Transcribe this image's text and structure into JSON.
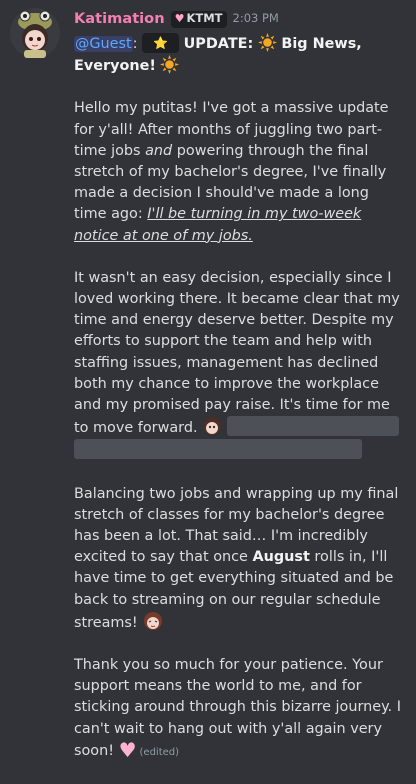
{
  "message": {
    "author": "Katimation",
    "author_color": "#f47fb0",
    "role_tag": {
      "icon": "pink-heart-icon",
      "label": "KTMT"
    },
    "timestamp": "2:03 PM",
    "mention": "@Guest",
    "mention_suffix": ":",
    "inline_badge_icon": "star-icon",
    "headline_prefix": "UPDATE:",
    "headline_suffix": "Big News, Everyone!",
    "p1": {
      "a": "Hello my putitas! I've got a massive update for y'all! After months of juggling two part-time jobs ",
      "b": "and",
      "c": " powering through the final stretch of my bachelor's degree, I've finally made a decision I should've made a long time ago: ",
      "d": "I'll be turning in my two-week notice at one of my jobs."
    },
    "p2": {
      "text": "It wasn't an easy decision, especially since I loved working there. It became clear that my time and energy deserve better. Despite my efforts to support the team and help with staffing issues, management has declined both my chance to improve the workplace and my promised pay raise. It's time for me to move forward."
    },
    "p3": {
      "a": "Balancing two jobs and wrapping up my final stretch of classes for my bachelor's degree has been a lot. That said… I'm incredibly excited to say that once ",
      "b": "August",
      "c": " rolls in, I'll have time to get everything situated and be back to streaming on our regular schedule streams!"
    },
    "p4": {
      "text": "Thank you so much for your patience. Your support means the world to me, and for sticking around through this bizarre journey. I can't wait to hang out with y'all again very soon!"
    },
    "edited_label": "(edited)",
    "colors": {
      "background": "#313338",
      "text": "#dbdee1",
      "mention": "#5ca9ff",
      "spoiler": "#4e5058"
    }
  }
}
